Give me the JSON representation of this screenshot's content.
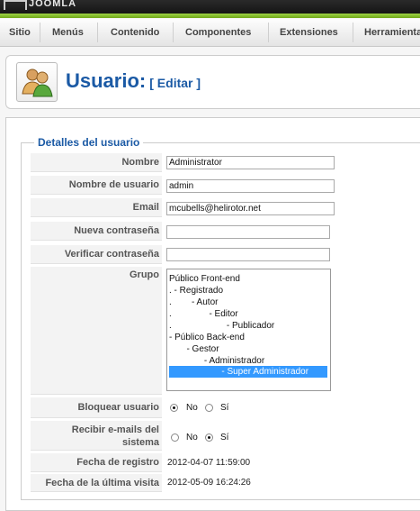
{
  "app": {
    "logo_text": "JOOMLA"
  },
  "menu": [
    "Sitio",
    "Menús",
    "Contenido",
    "Componentes",
    "Extensiones",
    "Herramientas"
  ],
  "header": {
    "title": "Usuario:",
    "subtitle": "[ Editar ]"
  },
  "form": {
    "legend": "Detalles del usuario",
    "fields": {
      "name": {
        "label": "Nombre",
        "value": "Administrator"
      },
      "username": {
        "label": "Nombre de usuario",
        "value": "admin"
      },
      "email": {
        "label": "Email",
        "value": "mcubells@helirotor.net"
      },
      "new_password": {
        "label": "Nueva contraseña",
        "value": ""
      },
      "verify_password": {
        "label": "Verificar contraseña",
        "value": ""
      }
    },
    "group": {
      "label": "Grupo",
      "options": [
        "Público Front-end",
        ". - Registrado",
        ".        - Autor",
        ".               - Editor",
        ".                      - Publicador",
        "- Público Back-end",
        "       - Gestor",
        "              - Administrador",
        "                     - Super Administrador"
      ],
      "selected": "                     - Super Administrador"
    },
    "block_user": {
      "label": "Bloquear usuario",
      "options": [
        "No",
        "Sí"
      ],
      "selected": "No"
    },
    "receive_email": {
      "label_line1": "Recibir e-mails del",
      "label_line2": "sistema",
      "options": [
        "No",
        "Sí"
      ],
      "selected": "Sí"
    },
    "register_date": {
      "label": "Fecha de registro",
      "value": "2012-04-07 11:59:00"
    },
    "last_visit": {
      "label": "Fecha de la última visita",
      "value": "2012-05-09 16:24:26"
    }
  },
  "colors": {
    "accent": "#1b5aa5",
    "green_bar": "#8bc53f",
    "selection": "#3399ff"
  }
}
